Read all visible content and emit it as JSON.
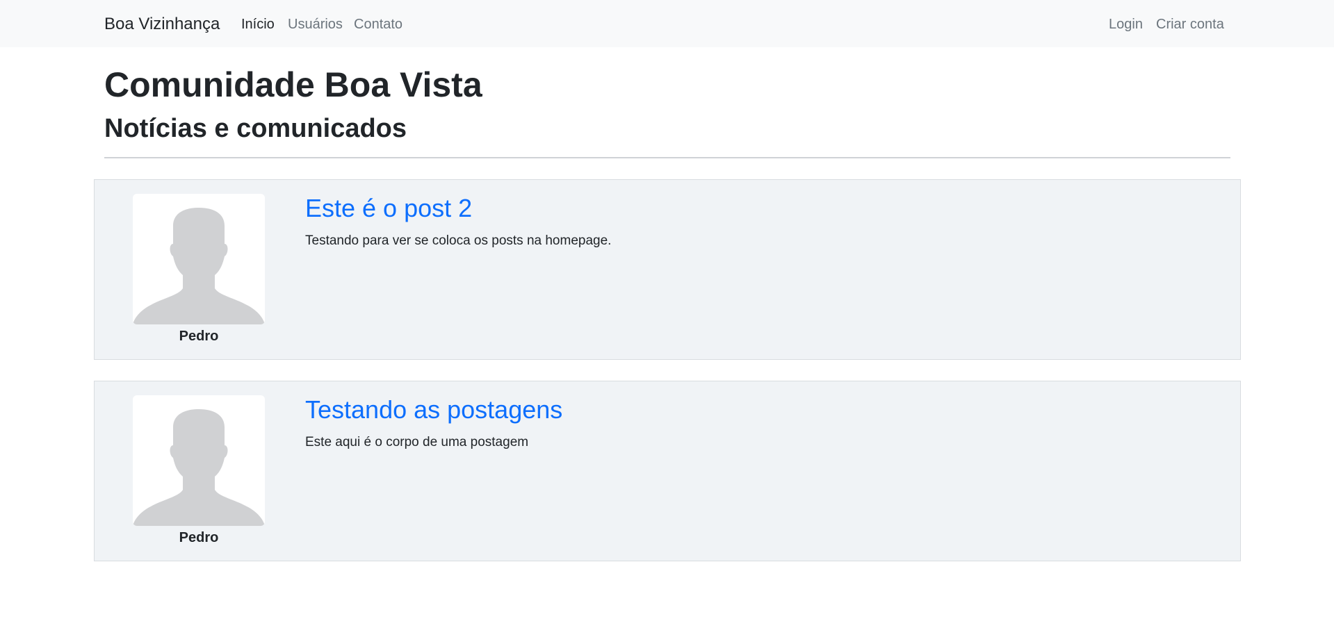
{
  "navbar": {
    "brand": "Boa Vizinhança",
    "links": [
      {
        "label": "Início",
        "active": true
      },
      {
        "label": "Usuários",
        "active": false
      },
      {
        "label": "Contato",
        "active": false
      }
    ],
    "right_links": [
      {
        "label": "Login"
      },
      {
        "label": "Criar conta"
      }
    ]
  },
  "header": {
    "title": "Comunidade Boa Vista",
    "subtitle": "Notícias e comunicados"
  },
  "posts": [
    {
      "title": "Este é o post 2",
      "body": "Testando para ver se coloca os posts na homepage.",
      "author": "Pedro",
      "avatar_icon": "default-user-avatar-icon"
    },
    {
      "title": "Testando as postagens",
      "body": "Este aqui é o corpo de uma postagem",
      "author": "Pedro",
      "avatar_icon": "default-user-avatar-icon"
    }
  ],
  "colors": {
    "navbar_bg": "#f8f9fa",
    "post_bg": "#f0f3f6",
    "link_blue": "#0d6efd",
    "avatar_silhouette": "#d0d1d3"
  }
}
